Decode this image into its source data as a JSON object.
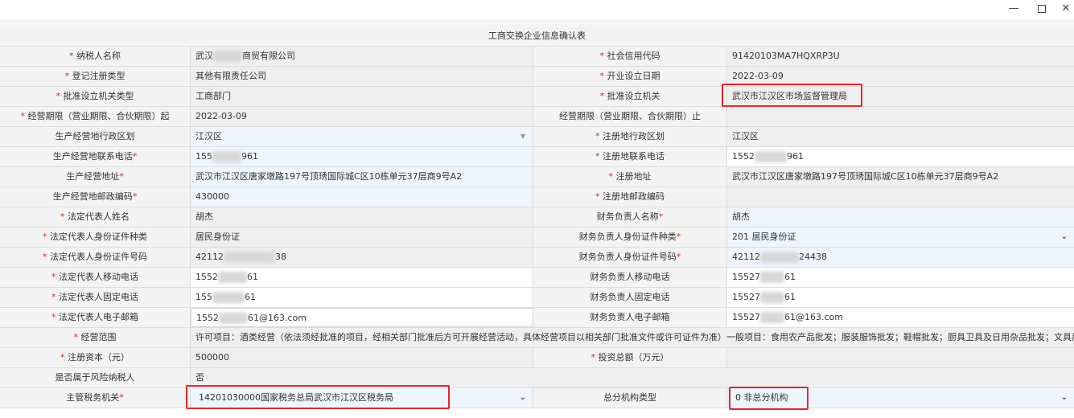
{
  "window": {
    "minimize_glyph": "—",
    "close_glyph": "✕"
  },
  "form_title": "工商交换企业信息确认表",
  "rows": {
    "taxpayer_name": {
      "label": "纳税人名称",
      "value_prefix": "武汉",
      "value_suffix": "商贸有限公司"
    },
    "credit_code": {
      "label": "社会信用代码",
      "value": "91420103MA7HQXRP3U"
    },
    "reg_type": {
      "label": "登记注册类型",
      "value": "其他有限责任公司"
    },
    "open_date": {
      "label": "开业设立日期",
      "value": "2022-03-09"
    },
    "approve_org_type": {
      "label": "批准设立机关类型",
      "value": "工商部门"
    },
    "approve_org": {
      "label": "批准设立机关",
      "value": "武汉市江汉区市场监督管理局"
    },
    "term_start": {
      "label": "经营期限（营业期限、合伙期限）起",
      "value": "2022-03-09"
    },
    "term_end": {
      "label": "经营期限（营业期限、合伙期限）止",
      "value": ""
    },
    "biz_district": {
      "label": "生产经营地行政区划",
      "value": "江汉区"
    },
    "reg_district": {
      "label": "注册地行政区划",
      "value": "江汉区"
    },
    "biz_phone": {
      "label": "生产经营地联系电话",
      "value_prefix": "155",
      "value_suffix": "961"
    },
    "reg_phone": {
      "label": "注册地联系电话",
      "value_prefix": "1552",
      "value_suffix": "961"
    },
    "biz_address": {
      "label": "生产经营地址",
      "value": "武汉市江汉区唐家墩路197号顶琇国际城C区10栋单元37层商9号A2"
    },
    "reg_address": {
      "label": "注册地址",
      "value": "武汉市江汉区唐家墩路197号顶琇国际城C区10栋单元37层商9号A2"
    },
    "biz_postcode": {
      "label": "生产经营地邮政编码",
      "value": "430000"
    },
    "reg_postcode": {
      "label": "注册地邮政编码",
      "value": ""
    },
    "legal_name": {
      "label": "法定代表人姓名",
      "value": "胡杰"
    },
    "finance_name": {
      "label": "财务负责人名称",
      "value": "胡杰"
    },
    "legal_id_type": {
      "label": "法定代表人身份证件种类",
      "value": "居民身份证"
    },
    "finance_id_type": {
      "label": "财务负责人身份证件种类",
      "value": "201 居民身份证"
    },
    "legal_id_no": {
      "label": "法定代表人身份证件号码",
      "value_prefix": "42112",
      "value_suffix": "38"
    },
    "finance_id_no": {
      "label": "财务负责人身份证件号码",
      "value_prefix": "42112",
      "value_suffix": "24438"
    },
    "legal_mobile": {
      "label": "法定代表人移动电话",
      "value_prefix": "1552",
      "value_suffix": "61"
    },
    "finance_mobile": {
      "label": "财务负责人移动电话",
      "value_prefix": "15527",
      "value_suffix": "61"
    },
    "legal_fixed": {
      "label": "法定代表人固定电话",
      "value_prefix": "155",
      "value_suffix": "61"
    },
    "finance_fixed": {
      "label": "财务负责人固定电话",
      "value_prefix": "15527",
      "value_suffix": "61"
    },
    "legal_email": {
      "label": "法定代表人电子邮箱",
      "value_prefix": "1552",
      "value_suffix": "61@163.com"
    },
    "finance_email": {
      "label": "财务负责人电子邮箱",
      "value_prefix": "15527",
      "value_suffix": "61@163.com"
    },
    "scope": {
      "label": "经营范围",
      "value": "许可项目：酒类经营（依法须经批准的项目，经相关部门批准后方可开展经营活动，具体经营项目以相关部门批准文件或许可证件为准）一般项目：食用农产品批发；服装服饰批发；鞋帽批发；厨具卫具及日用杂品批发；文具用品批发"
    },
    "capital": {
      "label": "注册资本（元）",
      "value": "500000"
    },
    "investment": {
      "label": "投资总额（万元）",
      "value": ""
    },
    "risk": {
      "label": "是否属于风险纳税人",
      "value": "否"
    },
    "tax_authority": {
      "label": "主管税务机关",
      "value": "14201030000国家税务总局武汉市江汉区税务局"
    },
    "branch_type": {
      "label": "总分机构类型",
      "value": "0 非总分机构"
    }
  },
  "colors": {
    "required": "#e2231a",
    "highlight": "#e3262d",
    "label_bg": "#f3f3f3",
    "value_bg": "#efefef"
  }
}
